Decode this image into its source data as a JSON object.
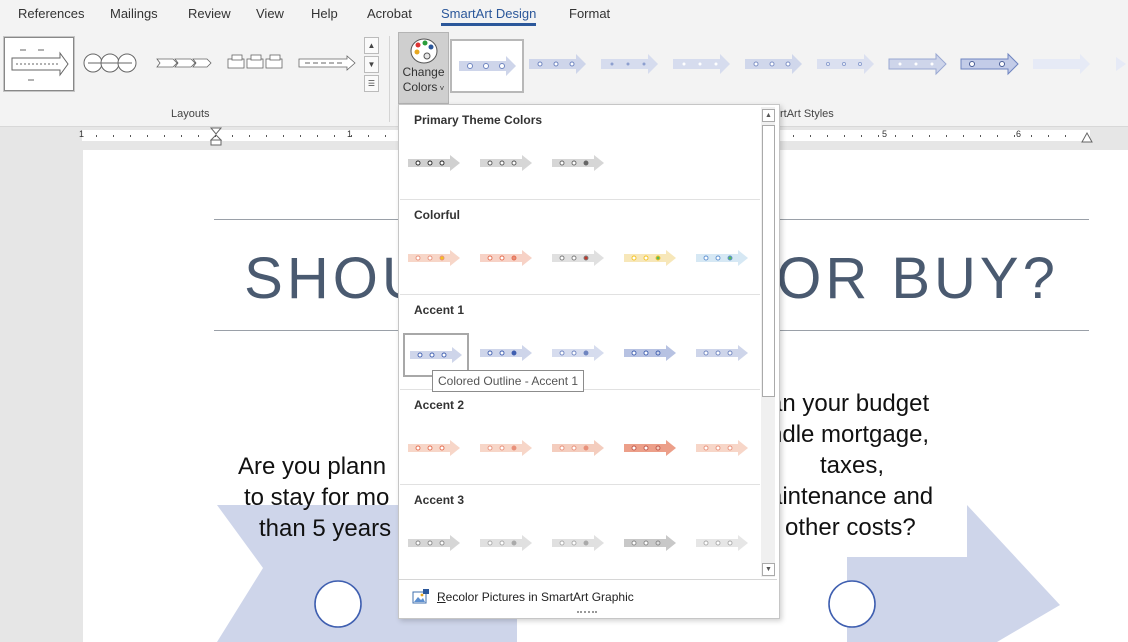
{
  "menu": {
    "tabs": [
      {
        "label": "References"
      },
      {
        "label": "Mailings"
      },
      {
        "label": "Review"
      },
      {
        "label": "View"
      },
      {
        "label": "Help"
      },
      {
        "label": "Acrobat"
      },
      {
        "label": "SmartArt Design",
        "active": true
      },
      {
        "label": "Format"
      }
    ]
  },
  "ribbon": {
    "layouts_label": "Layouts",
    "styles_label": "rtArt Styles",
    "change_colors_line1": "Change",
    "change_colors_line2": "Colors"
  },
  "ruler": {
    "numbers": [
      "1",
      "1",
      "5",
      "6"
    ]
  },
  "document": {
    "title_left": "SHOU",
    "title_right": "T OR BUY?",
    "left_text": [
      "Are you plann",
      "to stay for mo",
      "than 5 years"
    ],
    "right_text": [
      "an your budget",
      "ndle mortgage,",
      "taxes,",
      "aintenance and",
      "other costs?"
    ]
  },
  "dropdown": {
    "sections": [
      {
        "title": "Primary Theme Colors"
      },
      {
        "title": "Colorful"
      },
      {
        "title": "Accent 1"
      },
      {
        "title": "Accent 2"
      },
      {
        "title": "Accent 3"
      }
    ],
    "recolor_label": "Recolor Pictures in SmartArt Graphic",
    "tooltip": "Colored Outline - Accent 1"
  },
  "colors": {
    "accent": "#2b579a",
    "accent1": "#8094c8",
    "accent2": "#e8907a",
    "smartart_fill": "#ced5ea"
  }
}
